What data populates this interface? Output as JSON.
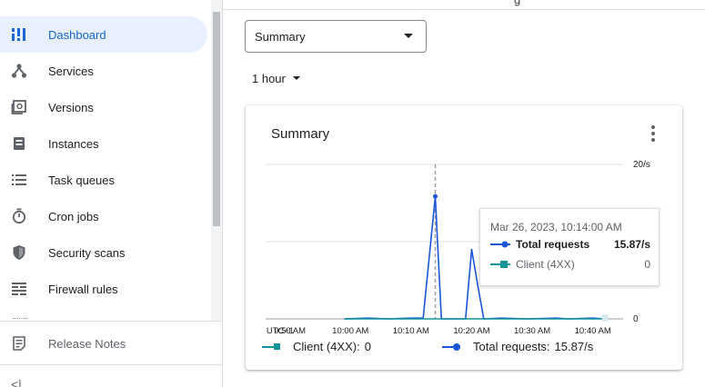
{
  "sidebar": {
    "items": [
      {
        "label": "Dashboard",
        "icon": "dashboard-icon",
        "active": true
      },
      {
        "label": "Services",
        "icon": "services-icon",
        "active": false
      },
      {
        "label": "Versions",
        "icon": "versions-icon",
        "active": false
      },
      {
        "label": "Instances",
        "icon": "instances-icon",
        "active": false
      },
      {
        "label": "Task queues",
        "icon": "task-queues-icon",
        "active": false
      },
      {
        "label": "Cron jobs",
        "icon": "cron-jobs-icon",
        "active": false
      },
      {
        "label": "Security scans",
        "icon": "security-scans-icon",
        "active": false
      },
      {
        "label": "Firewall rules",
        "icon": "firewall-rules-icon",
        "active": false
      }
    ],
    "release_notes": "Release Notes",
    "collapse_glyph": "<|"
  },
  "top_strip": {
    "partial_text": "g"
  },
  "view_select": {
    "value": "Summary"
  },
  "time_select": {
    "value": "1 hour"
  },
  "card": {
    "title": "Summary",
    "legend": [
      {
        "name": "Client (4XX):",
        "value": "0",
        "color": "#12939a"
      },
      {
        "name": "Total requests:",
        "value": "15.87/s",
        "color": "#1a56d6"
      }
    ],
    "tooltip": {
      "time": "Mar 26, 2023, 10:14:00 AM",
      "rows": [
        {
          "name": "Total requests",
          "value": "15.87/s",
          "color": "#1a56d6",
          "bold": true
        },
        {
          "name": "Client (4XX)",
          "value": "0",
          "color": "#12939a",
          "bold": false
        }
      ]
    }
  },
  "chart_data": {
    "type": "line",
    "title": "Summary",
    "x_tick_labels": [
      "UTC+1",
      "9:50 AM",
      "10:00 AM",
      "10:10 AM",
      "10:20 AM",
      "10:30 AM",
      "10:40 AM"
    ],
    "y_tick_labels": [
      "20/s",
      "0"
    ],
    "ylim": [
      0,
      20
    ],
    "xlim": [
      "9:46 AM",
      "10:45 AM"
    ],
    "hover_time": "10:14 AM",
    "grid": true,
    "series": [
      {
        "name": "Total requests",
        "color": "#1a56d6",
        "points": [
          [
            "9:59 AM",
            0
          ],
          [
            "10:03 AM",
            0.1
          ],
          [
            "10:06 AM",
            0
          ],
          [
            "10:10 AM",
            0.1
          ],
          [
            "10:12 AM",
            0.1
          ],
          [
            "10:14 AM",
            15.87
          ],
          [
            "10:15 AM",
            0
          ],
          [
            "10:19 AM",
            0
          ],
          [
            "10:20 AM",
            9.0
          ],
          [
            "10:21 AM",
            4.4
          ],
          [
            "10:22 AM",
            0
          ],
          [
            "10:25 AM",
            0.1
          ],
          [
            "10:29 AM",
            0
          ],
          [
            "10:34 AM",
            0.1
          ],
          [
            "10:36 AM",
            0
          ],
          [
            "10:40 AM",
            0.1
          ],
          [
            "10:42 AM",
            0
          ]
        ]
      },
      {
        "name": "Client (4XX)",
        "color": "#12939a",
        "points": [
          [
            "9:59 AM",
            0
          ],
          [
            "10:42 AM",
            0
          ]
        ]
      }
    ]
  }
}
